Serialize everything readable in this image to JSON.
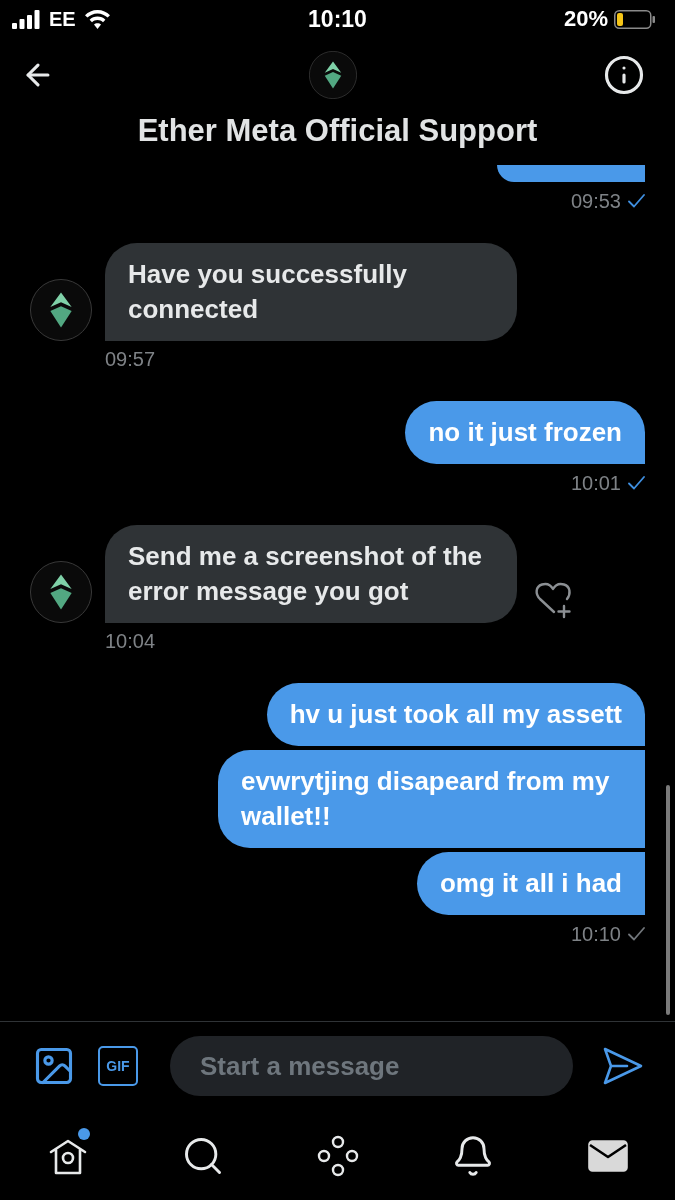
{
  "status_bar": {
    "carrier": "EE",
    "time": "10:10",
    "battery": "20%"
  },
  "header": {
    "title": "Ether Meta Official Support"
  },
  "messages": [
    {
      "kind": "sent",
      "time": "09:53",
      "read": true
    },
    {
      "kind": "received",
      "text": "Have you successfully connected",
      "time": "09:57",
      "reaction_prompt": false
    },
    {
      "kind": "sent",
      "text": "no it just frozen",
      "time": "10:01",
      "read": true
    },
    {
      "kind": "received",
      "text": "Send me a screenshot of the error message you got",
      "time": "10:04",
      "reaction_prompt": true
    },
    {
      "kind": "sent",
      "text": "hv u just took all my assett"
    },
    {
      "kind": "sent",
      "text": "evwrytjing disapeard from my wallet!!"
    },
    {
      "kind": "sent",
      "text": "omg it all i had",
      "time": "10:10",
      "read": false
    }
  ],
  "composer": {
    "gif_label": "GIF",
    "placeholder": "Start a message"
  },
  "nav": [
    {
      "kind": "home",
      "selected": false,
      "badge": true
    },
    {
      "kind": "search",
      "selected": false,
      "badge": false
    },
    {
      "kind": "communities",
      "selected": false,
      "badge": false
    },
    {
      "kind": "notifications",
      "selected": false,
      "badge": false
    },
    {
      "kind": "messages",
      "selected": true,
      "badge": false
    }
  ]
}
